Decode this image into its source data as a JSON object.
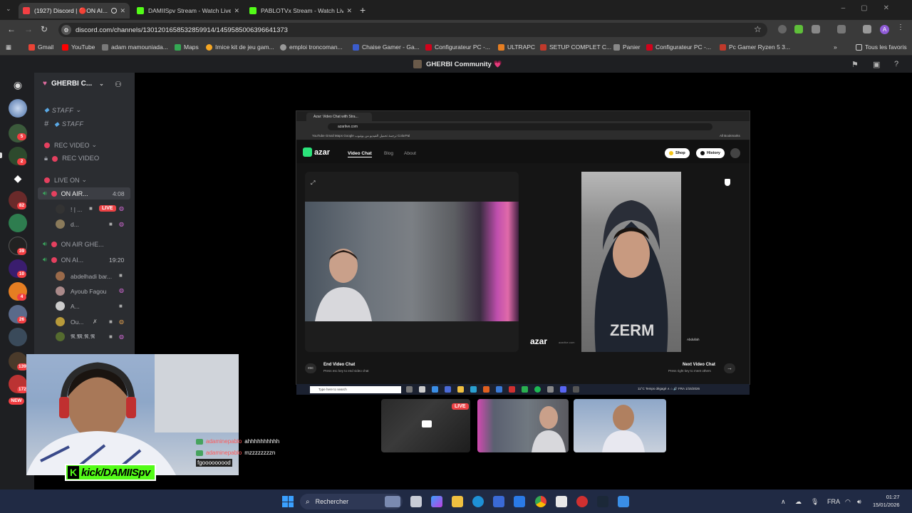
{
  "browser": {
    "tabs": [
      {
        "title": "(1927) Discord | 🔴ON AI...",
        "active": true,
        "color": "#f23f43"
      },
      {
        "title": "DAMIISpv Stream - Watch Live",
        "active": false,
        "color": "#53fc18"
      },
      {
        "title": "PABLOTVx Stream - Watch Live",
        "active": false,
        "color": "#53fc18"
      }
    ],
    "url": "discord.com/channels/1301201658532859914/1459585006396641373",
    "bookmarks": [
      {
        "label": "Gmail",
        "color": "#ea4335"
      },
      {
        "label": "YouTube",
        "color": "#ff0000"
      },
      {
        "label": "adam mamouniada...",
        "color": "#7a7a7a"
      },
      {
        "label": "Maps",
        "color": "#34a853"
      },
      {
        "label": "Imice kit de jeu gam...",
        "color": "#f5a623"
      },
      {
        "label": "emploi troncoman...",
        "color": "#999999"
      },
      {
        "label": "Chaise Gamer - Ga...",
        "color": "#3b5ccc"
      },
      {
        "label": "Configurateur PC -...",
        "color": "#d0021b"
      },
      {
        "label": "ULTRAPC",
        "color": "#e67e22"
      },
      {
        "label": "SETUP COMPLET C...",
        "color": "#c0392b"
      },
      {
        "label": "Panier",
        "color": "#888888"
      },
      {
        "label": "Configurateur PC -...",
        "color": "#d0021b"
      },
      {
        "label": "Pc Gamer Ryzen 5 3...",
        "color": "#c0392b"
      }
    ],
    "all_bookmarks": "Tous les favoris"
  },
  "discord": {
    "header_title": "GHERBI Community 💗",
    "guild_name": "GHERBI C...",
    "categories": {
      "staff": "STAFF",
      "rec": "REC VIDEO",
      "live": "LIVE ON"
    },
    "channels": {
      "staff": "STAFF",
      "rec": "REC VIDEO",
      "on_air_1": "ON AIR...",
      "on_air_2": "ON AIR GHE...",
      "on_air_3": "ON AI..."
    },
    "timers": {
      "on_air_1": "4:08",
      "on_air_3": "19:20"
    },
    "voice_users_1": [
      {
        "name": "! | ...",
        "live_label": "LIVE"
      },
      {
        "name": "d..."
      }
    ],
    "voice_users_3": [
      {
        "name": "abdelhadi bar..."
      },
      {
        "name": "Ayoub Fagou"
      },
      {
        "name": "A..."
      },
      {
        "name": "Ou..."
      },
      {
        "name": "𝕽.𝕸.𝕽.𝕽"
      }
    ],
    "server_badges": [
      "5",
      "2",
      "82",
      "39",
      "10",
      "4",
      "26",
      "139",
      "172",
      "NEW"
    ],
    "thumb_live": "LIVE"
  },
  "shared_screen": {
    "tab_title": "Azar: Video Chat with Stra...",
    "url": "azarlive.com",
    "bookmarks": "YouTube  Gmail  Maps  Google ترجمة  تحميل الفيديو من يوتيوب  ColorPal",
    "all_bookmarks": "All Bookmarks",
    "brand": "azar",
    "nav": [
      "Video Chat",
      "Blog",
      "About"
    ],
    "shop": "Shop",
    "history": "History",
    "watermark": "azar",
    "watermark_sub": "azarlive.com",
    "peer": "Abdullah",
    "end_title": "End Video Chat",
    "end_sub": "Press esc key to end video chat",
    "esc": "esc",
    "next_title": "Next Video Chat",
    "next_sub": "Press right key to meet others",
    "search": "Type here to search",
    "tray": "11°C  Temps dégagé  ∧  ⌂  🔊  FRA  1/15/2026"
  },
  "overlay": {
    "kick_handle": "kick/DAMIISpv",
    "chat": [
      {
        "user": "adaminepablo",
        "msg": "ahhhhhhhhhh"
      },
      {
        "user": "adaminepablo",
        "msg": "mzzzzzzzzn"
      }
    ],
    "chat_extra": "fgooooooood"
  },
  "taskbar": {
    "search": "Rechercher",
    "lang": "FRA",
    "time": "01:27",
    "date": "15/01/2026"
  }
}
